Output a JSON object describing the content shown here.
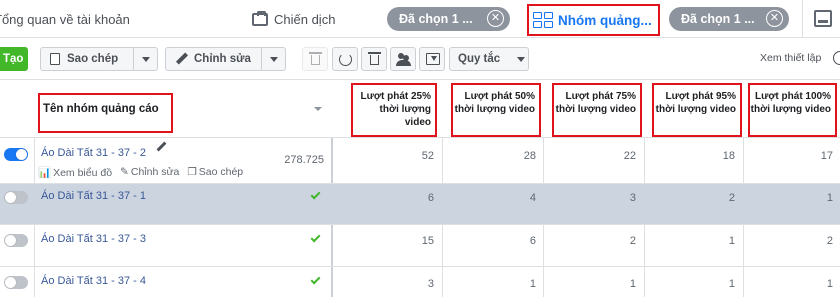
{
  "tabs": {
    "overview": "Tổng quan về tài khoản",
    "campaigns": "Chiến dịch",
    "selected_campaigns": "Đã chọn 1 ...",
    "adsets": "Nhóm quảng...",
    "selected_adsets": "Đã chọn 1 ..."
  },
  "toolbar": {
    "create": "Tạo",
    "copy": "Sao chép",
    "edit": "Chỉnh sửa",
    "rules": "Quy tắc",
    "view_setup": "Xem thiết lập"
  },
  "table": {
    "name_header": "Tên nhóm quảng cáo",
    "metric_headers": [
      "Lượt phát 25% thời lượng video",
      "Lượt phát 50% thời lượng video",
      "Lượt phát 75% thời lượng video",
      "Lượt phát 95% thời lượng video",
      "Lượt phát 100% thời lượng video"
    ],
    "row_actions": {
      "chart": "Xem biểu đồ",
      "edit": "Chỉnh sửa",
      "copy": "Sao chép"
    },
    "rows": [
      {
        "name": "Áo Dài Tất 31 - 37 - 2",
        "active": true,
        "reach": "278.725",
        "values": [
          "52",
          "28",
          "22",
          "18",
          "17"
        ]
      },
      {
        "name": "Áo Dài Tất 31 - 37 - 1",
        "active": false,
        "values": [
          "6",
          "4",
          "3",
          "2",
          "1"
        ]
      },
      {
        "name": "Áo Dài Tất 31 - 37 - 3",
        "active": false,
        "values": [
          "15",
          "6",
          "2",
          "1",
          "2"
        ]
      },
      {
        "name": "Áo Dài Tất 31 - 37 - 4",
        "active": false,
        "values": [
          "3",
          "1",
          "1",
          "1",
          "1"
        ]
      }
    ]
  },
  "colors": {
    "highlight_border": "#e0121c",
    "accent": "#1877f2",
    "create_green": "#42b72a",
    "selected_row": "#ccd4e0"
  }
}
